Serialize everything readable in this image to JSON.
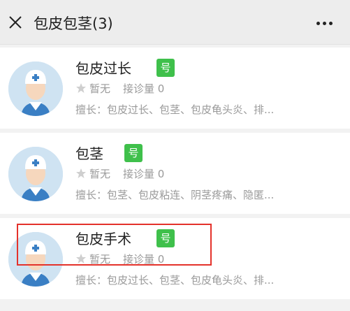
{
  "header": {
    "title": "包皮包茎(3)",
    "close_icon": "close-icon",
    "more_icon": "more-icon"
  },
  "results": [
    {
      "name": "包皮过长",
      "badge": "号",
      "rating": "暂无",
      "consult_label": "接诊量 0",
      "expertise": "擅长：包皮过长、包茎、包皮龟头炎、排..."
    },
    {
      "name": "包茎",
      "badge": "号",
      "rating": "暂无",
      "consult_label": "接诊量 0",
      "expertise": "擅长：包茎、包皮粘连、阴茎疼痛、隐匿..."
    },
    {
      "name": "包皮手术",
      "badge": "号",
      "rating": "暂无",
      "consult_label": "接诊量 0",
      "expertise": "擅长：包皮过长、包茎、包皮龟头炎、排..."
    }
  ],
  "colors": {
    "badge": "#3fc04b",
    "highlight": "#e4322b"
  }
}
